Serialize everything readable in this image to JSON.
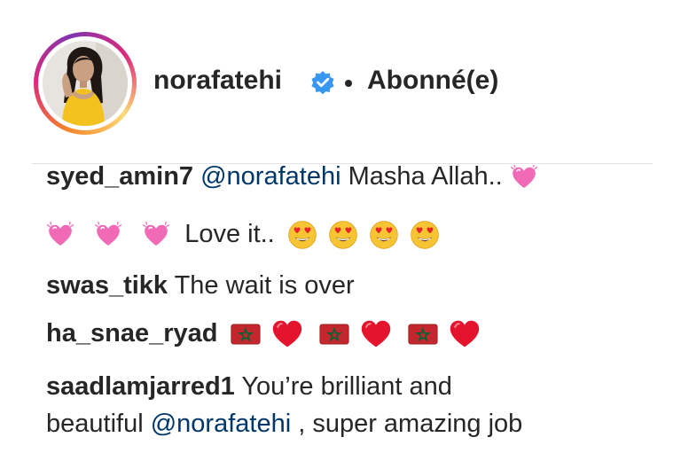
{
  "header": {
    "username": "norafatehi",
    "follow_status": "Abonné(e)",
    "avatar_icon": "profile-photo",
    "verified_icon": "verified-badge-icon",
    "story_ring_colors": [
      "#f58529",
      "#dd2a7b",
      "#8134af",
      "#feda77"
    ]
  },
  "comments": [
    {
      "user": "syed_amin7",
      "mention": "@norafatehi",
      "text_1": "Masha Allah..",
      "text_2": "Love it..",
      "emojis": [
        "sparkling-heart-icon",
        "sparkling-heart-icon",
        "sparkling-heart-icon",
        "sparkling-heart-icon",
        "heart-eyes-icon",
        "heart-eyes-icon",
        "heart-eyes-icon",
        "heart-eyes-icon"
      ]
    },
    {
      "user": "swas_tikk",
      "text": "The wait is over"
    },
    {
      "user": "ha_snae_ryad",
      "emojis": [
        "morocco-flag-icon",
        "red-heart-icon",
        "morocco-flag-icon",
        "red-heart-icon",
        "morocco-flag-icon",
        "red-heart-icon"
      ]
    },
    {
      "user": "saadlamjarred1",
      "text_1": "You’re brilliant and",
      "text_2": "beautiful",
      "mention": "@norafatehi",
      "text_3": ", super amazing job"
    }
  ],
  "colors": {
    "text": "#262626",
    "mention": "#00376b",
    "verified": "#3897f0",
    "divider": "#e3e3e3"
  }
}
